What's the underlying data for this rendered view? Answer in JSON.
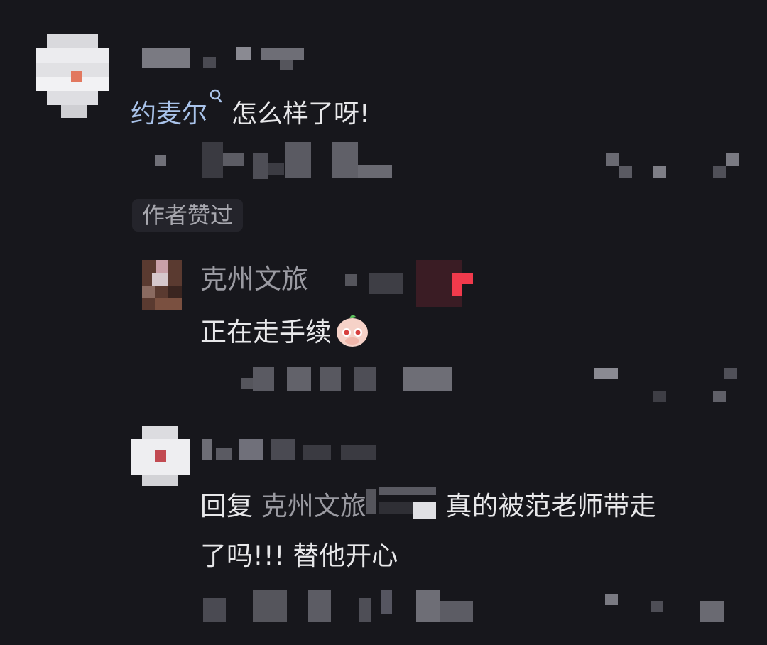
{
  "comment": {
    "mention": "约麦尔",
    "mention_icon": "search-icon",
    "text": "怎么样了呀!",
    "author_liked_badge": "作者赞过"
  },
  "reply1": {
    "username": "克州文旅",
    "text": "正在走手续",
    "emoji": "shy-peach-face"
  },
  "reply2": {
    "prefix": "回复",
    "target": "克州文旅",
    "text_line1": "真的被范老师带走",
    "text_line2": "了吗!!!  替他开心"
  },
  "colors": {
    "background": "#17171c",
    "text": "#e8e8ea",
    "mention": "#a9c3ea",
    "muted": "#9a9aa1"
  }
}
